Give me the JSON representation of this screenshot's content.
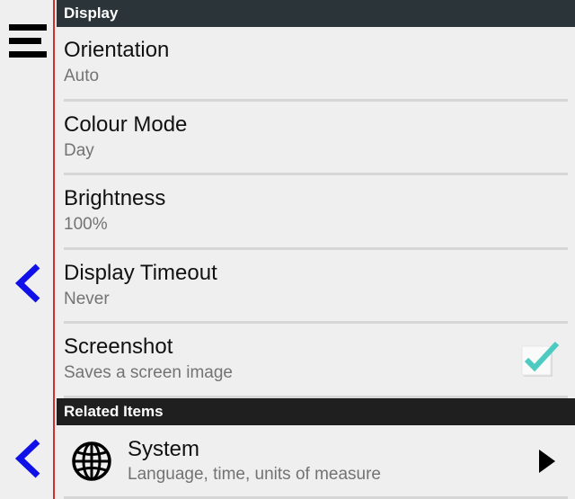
{
  "sections": {
    "display": "Display",
    "related": "Related Items"
  },
  "rows": [
    {
      "title": "Orientation",
      "sub": "Auto"
    },
    {
      "title": "Colour Mode",
      "sub": "Day"
    },
    {
      "title": "Brightness",
      "sub": "100%"
    },
    {
      "title": "Display Timeout",
      "sub": "Never"
    },
    {
      "title": "Screenshot",
      "sub": "Saves a screen image"
    }
  ],
  "screenshot": {
    "checked": true
  },
  "related": {
    "title": "System",
    "sub": "Language, time, units of measure"
  },
  "colors": {
    "rail_divider": "#d32f2f",
    "back_arrow": "#1010e8",
    "check": "#4ecbc0",
    "header_bg": "#2b3438"
  },
  "icons": {
    "menu": "hamburger-menu-icon",
    "back": "chevron-left-icon",
    "check": "checkbox-checked-icon",
    "globe": "globe-icon",
    "forward": "play-right-icon"
  }
}
